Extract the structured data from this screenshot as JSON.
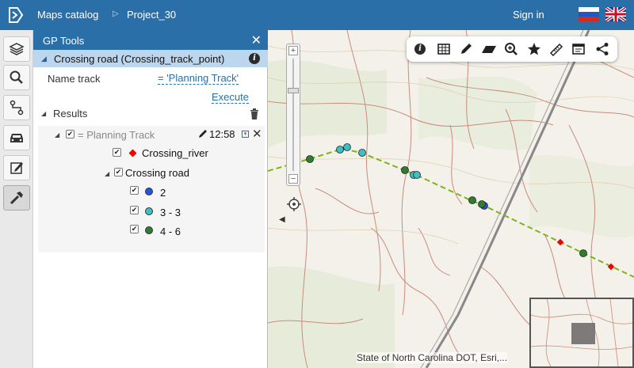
{
  "header": {
    "catalog_label": "Maps catalog",
    "project_label": "Project_30",
    "signin_label": "Sign in"
  },
  "panel": {
    "title": "GP Tools",
    "tool_name": "Crossing road (Crossing_track_point)",
    "name_track_label": "Name track",
    "name_track_value": "= 'Planning Track'",
    "execute_label": "Execute",
    "results_label": "Results",
    "result_item": "= Planning Track",
    "result_time": "12:58",
    "river_label": "Crossing_river",
    "road_label": "Crossing road",
    "legend": [
      {
        "label": "2",
        "color": "#2255dd"
      },
      {
        "label": "3 - 3",
        "color": "#3fbfbf"
      },
      {
        "label": "4 - 6",
        "color": "#2e7d32"
      }
    ]
  },
  "map": {
    "attribution": "State of North Carolina DOT, Esri,..."
  },
  "icons": [
    "logo-icon",
    "layers-icon",
    "search-icon",
    "route-icon",
    "car-icon",
    "edit-icon",
    "hammer-icon",
    "info-icon",
    "table-icon",
    "pencil-icon",
    "eraser-icon",
    "zoom-icon",
    "star-icon",
    "ruler-icon",
    "print-icon",
    "share-icon",
    "close-icon",
    "trash-icon",
    "locate-icon"
  ],
  "colors": {
    "accent": "#2a6fa8",
    "track_line": "#7cb518",
    "selected_row": "#bcd6ee"
  }
}
